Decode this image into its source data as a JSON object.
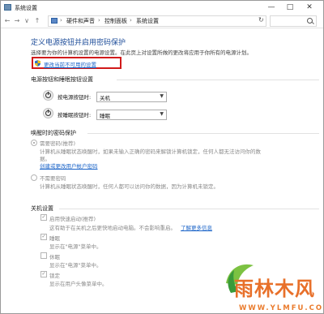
{
  "window": {
    "title": "系统设置",
    "controls": {
      "minimize": "—",
      "maximize": "□",
      "close": "✕"
    }
  },
  "address": {
    "breadcrumbs": [
      "硬件和声音",
      "控制面板",
      "系统设置"
    ],
    "separator": "›",
    "nav": {
      "back": "←",
      "forward": "→",
      "up": "↑",
      "recent": "∨",
      "refresh": "↻"
    }
  },
  "main": {
    "heading": "定义电源按钮并启用密码保护",
    "description": "选择要为你的计算机设置的电源设置。在此页上对设置所做的更改将应用于你所有的电源计划。",
    "change_link": "更改当前不可用的设置"
  },
  "buttons_section": {
    "title": "电源按钮和睡眠按钮设置",
    "rows": [
      {
        "label": "按电源按钮时:",
        "value": "关机"
      },
      {
        "label": "按睡眠按钮时:",
        "value": "睡眠"
      }
    ]
  },
  "password_section": {
    "title": "唤醒时的密码保护",
    "options": [
      {
        "label": "需要密码(推荐)",
        "desc_line1": "计算机从睡眠状态唤醒时，如果未输入正确的密码来解锁计算机锁定，任何人都无法访问你的数",
        "desc_line2": "据。",
        "link": "创建或更改用户帐户密码",
        "selected": true
      },
      {
        "label": "不需要密码",
        "desc_line1": "计算机从睡眠状态唤醒时，任何人都可以访问你的数据，因为计算机未锁定。",
        "selected": false
      }
    ]
  },
  "shutdown_section": {
    "title": "关机设置",
    "items": [
      {
        "label": "启用快速启动(推荐)",
        "desc": "这有助于在关机之后更快地启动电脑。不会影响重启。",
        "link": "了解更多信息",
        "checked": true
      },
      {
        "label": "睡眠",
        "desc": "显示在\"电源\"菜单中。",
        "checked": true
      },
      {
        "label": "休眠",
        "desc": "显示在\"电源\"菜单中。",
        "checked": false
      },
      {
        "label": "锁定",
        "desc": "显示在用户头像菜单中。",
        "checked": true
      }
    ]
  },
  "watermark": {
    "text": "雨林木风",
    "url": "WWW.YLMFU.COM"
  },
  "colors": {
    "heading": "#1f4e9a",
    "link": "#1b64c8",
    "highlight": "#d11a1a",
    "watermark": "#e8702a"
  }
}
